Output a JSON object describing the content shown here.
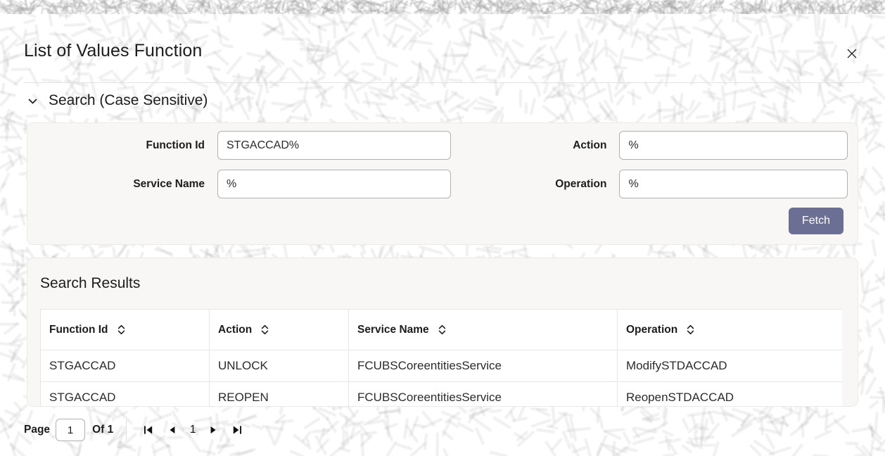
{
  "window": {
    "title": "List of Values Function",
    "close_label": "×"
  },
  "search_section": {
    "heading": "Search (Case Sensitive)",
    "chevron_icon": "chevron-down-icon",
    "fields": {
      "function_id": {
        "label": "Function Id",
        "value": "STGACCAD%",
        "placeholder": ""
      },
      "service_name": {
        "label": "Service Name",
        "value": "%",
        "placeholder": ""
      },
      "action": {
        "label": "Action",
        "value": "%",
        "placeholder": ""
      },
      "operation": {
        "label": "Operation",
        "value": "%",
        "placeholder": ""
      }
    },
    "fetch_label": "Fetch"
  },
  "results": {
    "title": "Search Results",
    "columns": [
      {
        "label": "Function Id",
        "sort_icon": "sort-updown-icon"
      },
      {
        "label": "Action",
        "sort_icon": "sort-updown-icon"
      },
      {
        "label": "Service Name",
        "sort_icon": "sort-updown-icon"
      },
      {
        "label": "Operation",
        "sort_icon": "sort-updown-icon"
      }
    ],
    "rows": [
      {
        "function_id": "STGACCAD",
        "action": "UNLOCK",
        "service_name": "FCUBSCoreentitiesService",
        "operation": "ModifySTDACCAD"
      },
      {
        "function_id": "STGACCAD",
        "action": "REOPEN",
        "service_name": "FCUBSCoreentitiesService",
        "operation": "ReopenSTDACCAD"
      }
    ]
  },
  "pagination": {
    "page_label": "Page",
    "page_value": "1",
    "of_label": "Of 1",
    "current_page": "1",
    "first_icon": "first-page-icon",
    "prev_icon": "previous-page-icon",
    "next_icon": "next-page-icon",
    "last_icon": "last-page-icon"
  },
  "colors": {
    "accent_button": "#6a6f93",
    "panel_bg": "#f8f7f5",
    "text": "#1c1c1c",
    "border": "#b3b1ae"
  }
}
